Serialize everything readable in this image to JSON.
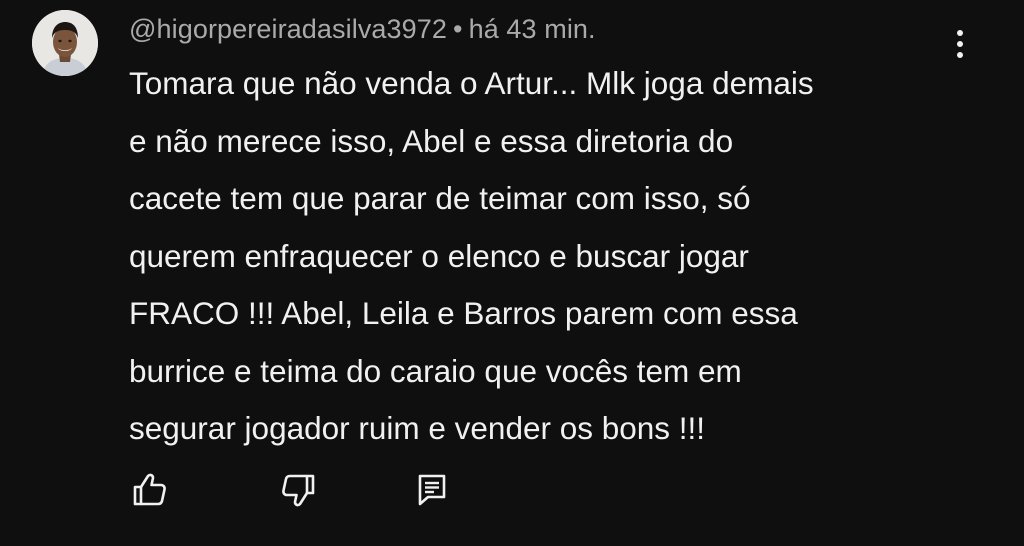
{
  "comment": {
    "avatar_icon": "user-avatar-photo",
    "author": "@higorpereiradasilva3972",
    "separator": "•",
    "time": "há 43 min.",
    "text_lines": [
      "Tomara que não venda o Artur... Mlk joga demais",
      "e não merece isso, Abel e essa diretoria do",
      "cacete tem que parar de teimar com isso, só",
      "querem enfraquecer o elenco e buscar jogar",
      "FRACO !!! Abel, Leila e Barros parem com essa",
      "burrice e teima do caraio que vocês tem em",
      "segurar jogador ruim e vender os bons !!!"
    ],
    "actions": {
      "like_icon": "thumbs-up-icon",
      "dislike_icon": "thumbs-down-icon",
      "reply_icon": "reply-comment-icon",
      "menu_icon": "more-vertical-icon"
    }
  },
  "colors": {
    "background": "#0f0f0f",
    "text": "#f1f1f1",
    "meta": "#aaaaaa"
  }
}
